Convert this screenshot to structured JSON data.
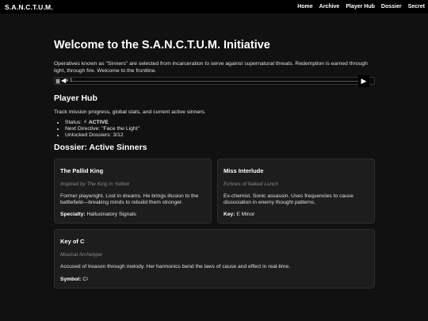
{
  "header": {
    "brand": "S.A.N.C.T.U.M.",
    "nav": [
      "Home",
      "Archive",
      "Player Hub",
      "Dossier",
      "Secret"
    ]
  },
  "main": {
    "title": "Welcome to the S.A.N.C.T.U.M. Initiative",
    "intro": "Operatives known as \"Sinners\" are selected from incarceration to serve against supernatural threats. Redemption is earned through light, through fire. Welcome to the frontline."
  },
  "player": {
    "track_label": "e 1",
    "prev_symbol": "◀",
    "next_symbol": "▶"
  },
  "hub": {
    "title": "Player Hub",
    "description": "Track mission progress, global stats, and current active sinners.",
    "status_label": "Status:",
    "status_icon": "⚡",
    "status_value": "ACTIVE",
    "directive": "Next Directive: \"Face the Light\"",
    "dossiers": "Unlocked Dossiers: 3/12"
  },
  "dossier": {
    "title": "Dossier: Active Sinners",
    "cards": [
      {
        "name": "The Pallid King",
        "inspiration": "Inspired by The King in Yellow",
        "description": "Former playwright. Lost in dreams. He brings illusion to the battlefield—breaking minds to rebuild them stronger.",
        "attr_label": "Specialty:",
        "attr_value": "Hallucinatory Signals"
      },
      {
        "name": "Miss Interlude",
        "inspiration": "Echoes of Naked Lunch",
        "description": "Ex-chemist. Sonic assassin. Uses frequencies to cause dissociation in enemy thought patterns.",
        "attr_label": "Key:",
        "attr_value": "E Minor"
      },
      {
        "name": "Key of C",
        "inspiration": "Musical Archetype",
        "description": "Accused of treason through melody. Her harmonics bend the laws of cause and effect in real-time.",
        "attr_label": "Symbol:",
        "attr_value": "C♮"
      }
    ]
  },
  "colors": {
    "background": "#111111",
    "topbar": "#000000",
    "card": "#1d1d1d",
    "muted": "#8a8a8a"
  }
}
